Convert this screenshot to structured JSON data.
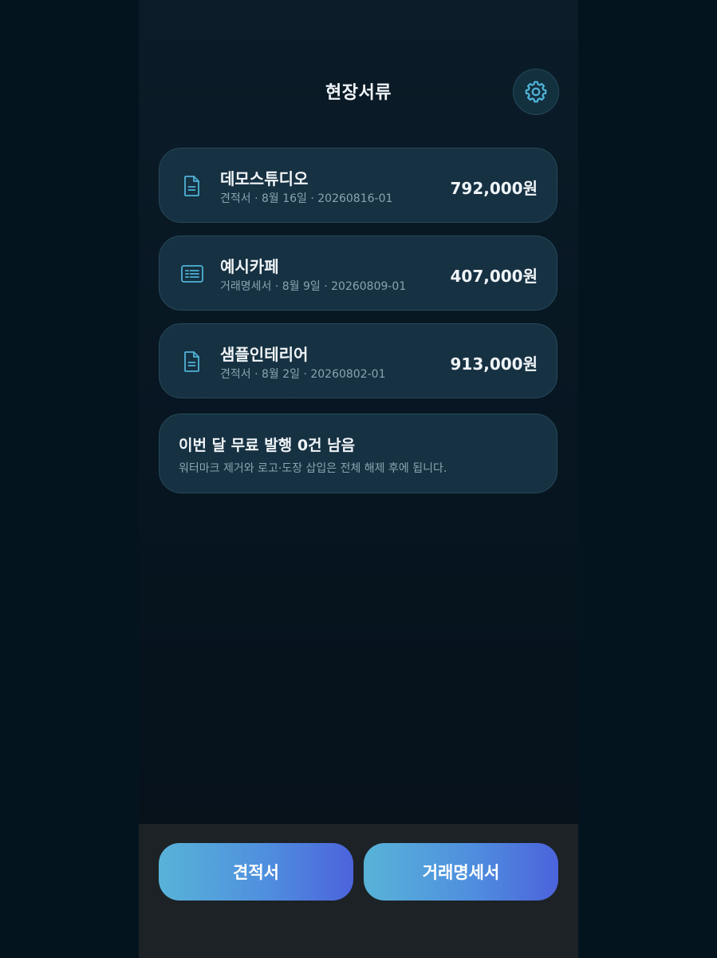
{
  "header": {
    "title": "현장서류",
    "settings_icon": "gear-icon"
  },
  "documents": [
    {
      "icon": "document-icon",
      "client": "데모스튜디오",
      "meta": "견적서 · 8월 16일 · 20260816-01",
      "amount": "792,000원"
    },
    {
      "icon": "receipt-list-icon",
      "client": "예시카페",
      "meta": "거래명세서 · 8월 9일 · 20260809-01",
      "amount": "407,000원"
    },
    {
      "icon": "document-icon",
      "client": "샘플인테리어",
      "meta": "견적서 · 8월 2일 · 20260802-01",
      "amount": "913,000원"
    }
  ],
  "notice": {
    "title": "이번 달 무료 발행 0건 남음",
    "subtitle": "워터마크 제거와 로고·도장 삽입은 전체 해제 후에 됩니다."
  },
  "actions": {
    "estimate_label": "견적서",
    "statement_label": "거래명세서"
  },
  "colors": {
    "background": "#04141f",
    "card": "#163142",
    "accent_icon": "#4fb2d6",
    "button_gradient_start": "#58b3d8",
    "button_gradient_end": "#4c63dc"
  }
}
